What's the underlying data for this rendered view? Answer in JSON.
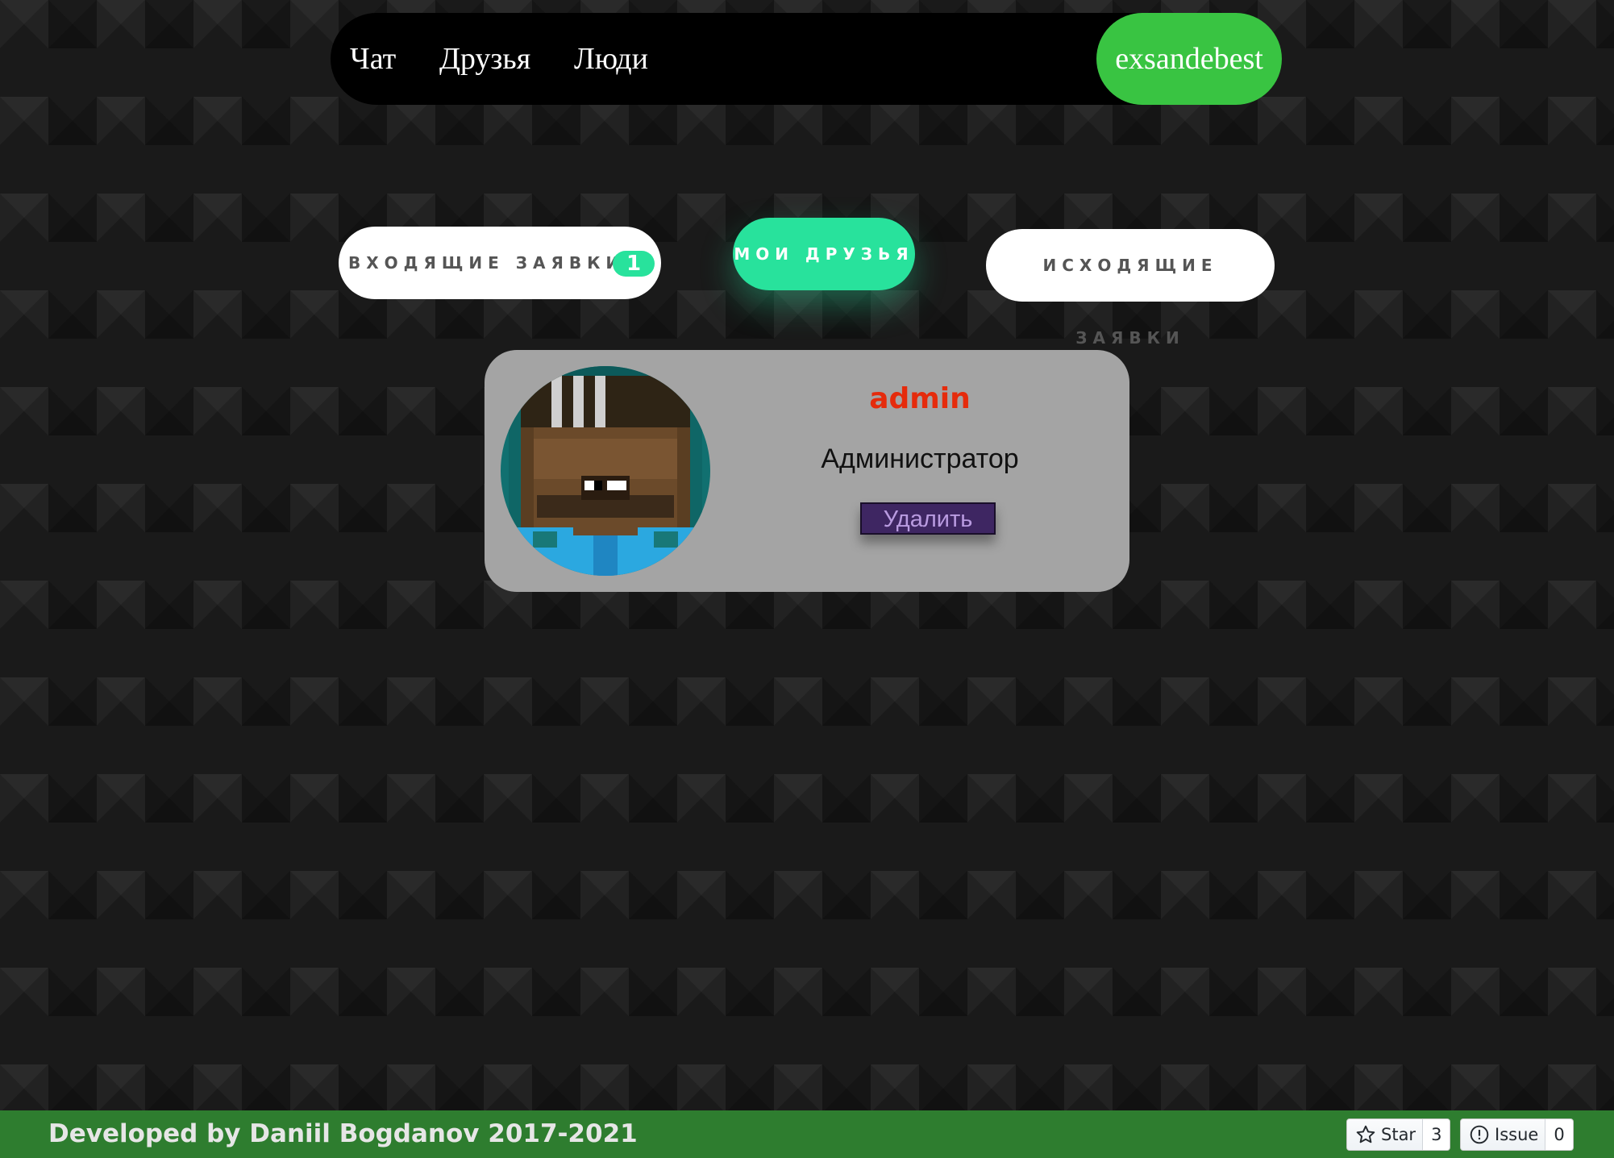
{
  "colors": {
    "nav_user_bg": "#39c442",
    "tab_active_bg": "#28e29c",
    "badge_bg": "#28e29c",
    "friend_name": "#e52b0c",
    "delete_bg": "#3e2662",
    "delete_text": "#b99be0",
    "footer_bg": "#2e7d2f"
  },
  "nav": {
    "links": [
      "Чат",
      "Друзья",
      "Люди"
    ],
    "username": "exsandebest"
  },
  "tabs": {
    "incoming": {
      "label": "ВХОДЯЩИЕ ЗАЯВКИ",
      "badge": "1"
    },
    "friends": {
      "label": "МОИ ДРУЗЬЯ",
      "active": true
    },
    "outgoing": {
      "label": "ИСХОДЯЩИЕ ЗАЯВКИ"
    }
  },
  "friend": {
    "name": "admin",
    "role": "Администратор",
    "delete_label": "Удалить",
    "avatar_icon": "pixel-character-avatar"
  },
  "footer": {
    "text": "Developed by Daniil Bogdanov 2017-2021",
    "star": {
      "label": "Star",
      "count": "3",
      "icon": "star-icon"
    },
    "issue": {
      "label": "Issue",
      "count": "0",
      "icon": "issue-icon"
    }
  }
}
